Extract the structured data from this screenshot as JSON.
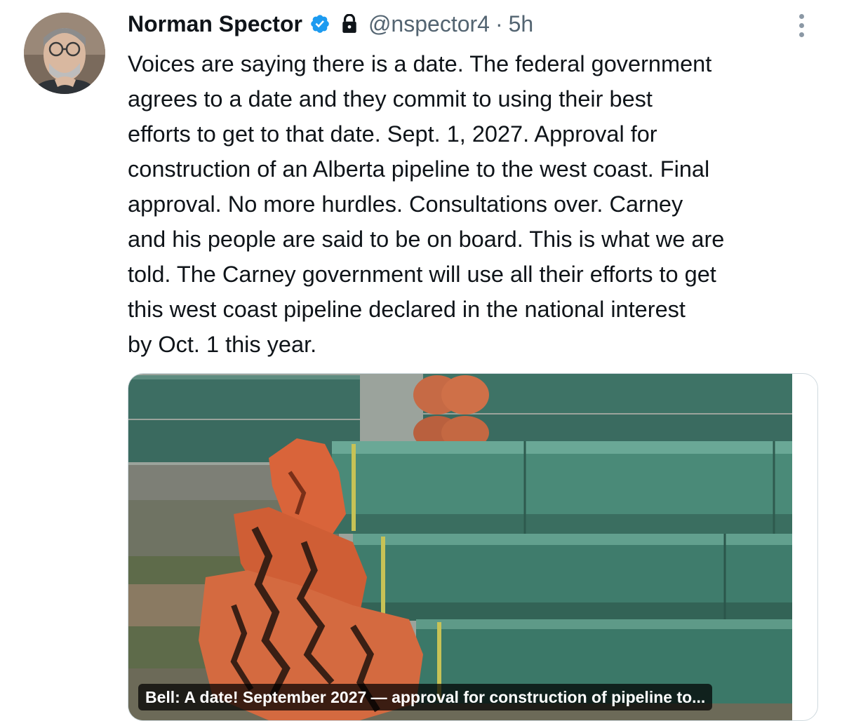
{
  "tweet": {
    "author_name": "Norman Spector",
    "handle": "@nspector4",
    "separator": "·",
    "time": "5h",
    "verified_icon": "verified-badge-icon",
    "protected_icon": "lock-icon",
    "more_icon": "more-vertical-icon",
    "text_lines": [
      "Voices are saying there is a date. The federal government",
      "agrees to a date and they commit to using their best",
      "efforts to get to that date. Sept. 1, 2027. Approval for",
      "construction of an Alberta pipeline to the west coast. Final",
      "approval. No more hurdles. Consultations over. Carney",
      "and his people are said to be on board. This is what we are",
      "told.  The Carney government will use all their efforts to get",
      "this west coast pipeline declared in the national interest",
      "by Oct. 1 this year."
    ]
  },
  "link_card": {
    "caption": "Bell: A date! September 2027 — approval for construction of pipeline to..."
  },
  "colors": {
    "verified_blue": "#1d9bf0",
    "secondary_text": "#536471",
    "pipe_green": "#3f7a6a",
    "wrap_orange": "#d9643a"
  }
}
